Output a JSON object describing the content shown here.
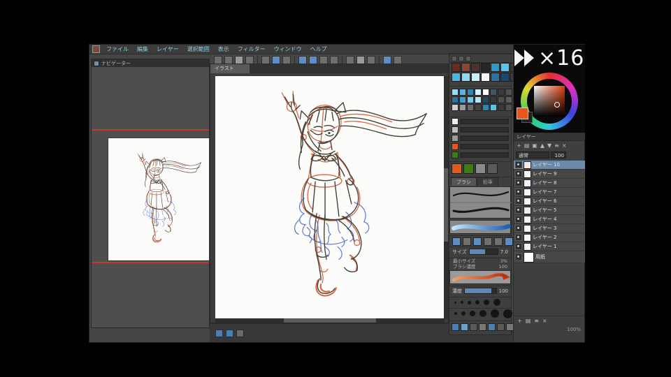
{
  "playback": {
    "speed": "×16"
  },
  "menu": {
    "items": [
      "ファイル",
      "編集",
      "レイヤー",
      "選択範囲",
      "表示",
      "フィルター",
      "ウィンドウ",
      "ヘルプ"
    ]
  },
  "navigator": {
    "title": "ナビゲーター"
  },
  "document": {
    "tab": "イラスト"
  },
  "colors": {
    "guide_red": "#c0392a",
    "current": "#e8561c",
    "selection": "#6d89aa"
  },
  "palette": {
    "row1": [
      "#6a2a22",
      "#8a4632",
      "#4a342c",
      "#262626",
      "#2e9ac8",
      "#57c4ea",
      "#3c3c3c"
    ],
    "row2": [
      "#45b8e6",
      "#8fd9f4",
      "#c9eefb",
      "#f4fbfe",
      "#2a72a4",
      "#174a72",
      "#3c3c3c"
    ]
  },
  "colorsets": {
    "row1": [
      "#9adcf0",
      "#5ab4dc",
      "#2f88b8",
      "#d8f0f8",
      "#ffffff",
      "#46565e",
      "#3a3a3a",
      "#505050"
    ],
    "row2": [
      "#2a72a4",
      "#3fa0cf",
      "#77c7e8",
      "#b5e4f5",
      "#274a5a",
      "#3a3a3a",
      "#505050",
      "#5c5c5c"
    ],
    "row3": [
      "#cfcfcf",
      "#9a9a9a",
      "#6a6a6a",
      "#444444",
      "#2e86b0",
      "#57c4ea",
      "#3a3a3a",
      "#505050"
    ]
  },
  "mixer": {
    "chips": [
      "#f0f0f0",
      "#c0c0c0",
      "#9a9a9a",
      "#e8561c",
      "#3f7a16"
    ]
  },
  "swatches2": [
    "#e05a1a",
    "#3f7a16",
    "#8a8a8a",
    "#5a5a5a"
  ],
  "footer_icons": [
    "#4a80b0",
    "#6aa0c8",
    "#5a5a5a",
    "#777777",
    "#4a80b0",
    "#5a5a5a",
    "#777777",
    "#5a5a5a"
  ],
  "tool": {
    "tabs": [
      "ブラシ",
      "鉛筆"
    ],
    "sliders": [
      {
        "label": "サイズ",
        "value": "7.0"
      },
      {
        "label": "濃度",
        "value": "100"
      }
    ],
    "details": [
      {
        "label": "最小サイズ",
        "value": "3%"
      },
      {
        "label": "ブラシ濃度",
        "value": "100"
      }
    ]
  },
  "layers": {
    "panel_title": "レイヤー",
    "blend_label": "通常",
    "opacity_value": "100",
    "items": [
      {
        "name": "レイヤー 10",
        "thumb": "#f6e9df"
      },
      {
        "name": "レイヤー 9",
        "thumb": "#f5f5f5"
      },
      {
        "name": "レイヤー 8",
        "thumb": "#edf2f8"
      },
      {
        "name": "レイヤー 7",
        "thumb": "#f5f5f5"
      },
      {
        "name": "レイヤー 6",
        "thumb": "#f5f5f5"
      },
      {
        "name": "レイヤー 5",
        "thumb": "#f3ece6"
      },
      {
        "name": "レイヤー 4",
        "thumb": "#f5f5f5"
      },
      {
        "name": "レイヤー 3",
        "thumb": "#f5f5f5"
      },
      {
        "name": "レイヤー 2",
        "thumb": "#f5f5f5"
      },
      {
        "name": "レイヤー 1",
        "thumb": "#f5f5f5"
      }
    ],
    "paper_name": "用紙",
    "status": "100%"
  },
  "status": {
    "zoom": "100%"
  },
  "icons": {
    "new": "+",
    "folder": "▤",
    "dup": "▣",
    "up": "▲",
    "down": "▼",
    "opt": "≡",
    "trash": "×",
    "prev": "◀",
    "next": "▶"
  }
}
